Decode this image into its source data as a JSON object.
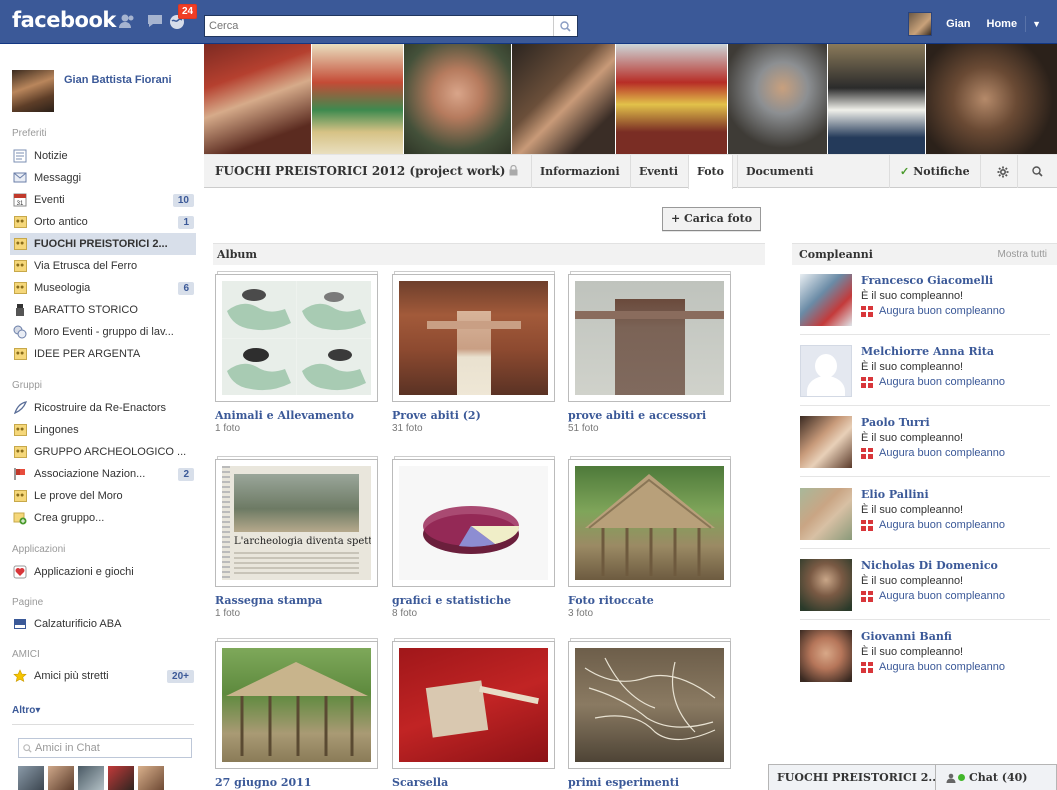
{
  "topbar": {
    "logo": "facebook",
    "notification_count": "24",
    "search_placeholder": "Cerca",
    "user_name": "Gian",
    "home_label": "Home"
  },
  "sidebar": {
    "profile_name": "Gian Battista Fiorani",
    "sections": {
      "preferiti": "Preferiti",
      "gruppi": "Gruppi",
      "applicazioni": "Applicazioni",
      "pagine": "Pagine",
      "amici": "AMICI"
    },
    "preferiti": [
      {
        "label": "Notizie",
        "count": "",
        "icon": "news-icon"
      },
      {
        "label": "Messaggi",
        "count": "",
        "icon": "messages-icon"
      },
      {
        "label": "Eventi",
        "count": "10",
        "icon": "calendar-icon"
      },
      {
        "label": "Orto antico",
        "count": "1",
        "icon": "group-icon"
      },
      {
        "label": "FUOCHI PREISTORICI 2...",
        "count": "",
        "icon": "group-icon"
      },
      {
        "label": "Via Etrusca del Ferro",
        "count": "",
        "icon": "group-icon"
      },
      {
        "label": "Museologia",
        "count": "6",
        "icon": "group-icon"
      },
      {
        "label": "BARATTO STORICO",
        "count": "",
        "icon": "figure-icon"
      },
      {
        "label": "Moro Eventi - gruppo di lav...",
        "count": "",
        "icon": "chat-group-icon"
      },
      {
        "label": "IDEE PER ARGENTA",
        "count": "",
        "icon": "group-icon"
      }
    ],
    "gruppi": [
      {
        "label": "Ricostruire da Re-Enactors",
        "count": "",
        "icon": "feather-icon"
      },
      {
        "label": "Lingones",
        "count": "",
        "icon": "group-icon"
      },
      {
        "label": "GRUPPO ARCHEOLOGICO ...",
        "count": "",
        "icon": "group-icon"
      },
      {
        "label": "Associazione Nazion...",
        "count": "2",
        "icon": "flag-icon"
      },
      {
        "label": "Le prove del Moro",
        "count": "",
        "icon": "group-icon"
      },
      {
        "label": "Crea gruppo...",
        "count": "",
        "icon": "add-group-icon"
      }
    ],
    "applicazioni": [
      {
        "label": "Applicazioni e giochi",
        "count": "",
        "icon": "apps-icon"
      }
    ],
    "pagine": [
      {
        "label": "Calzaturificio ABA",
        "count": "",
        "icon": "page-icon"
      }
    ],
    "amici": [
      {
        "label": "Amici più stretti",
        "count": "20+",
        "icon": "star-icon"
      }
    ],
    "altro": "Altro",
    "chat_search_placeholder": "Amici in Chat"
  },
  "group": {
    "title": "FUOCHI PREISTORICI 2012 (project work)",
    "tabs": [
      "Informazioni",
      "Eventi",
      "Foto",
      "Documenti"
    ],
    "active_tab": "Foto",
    "notifications": "Notifiche"
  },
  "upload_button": "+ Carica foto",
  "albums_header": "Album",
  "albums": [
    {
      "title": "Animali e Allevamento",
      "count": "1 foto"
    },
    {
      "title": "Prove abiti (2)",
      "count": "31 foto"
    },
    {
      "title": "prove abiti e accessori",
      "count": "51 foto"
    },
    {
      "title": "Rassegna stampa",
      "count": "1 foto",
      "thumb_text": "L'archeologia diventa spettac"
    },
    {
      "title": "grafici e statistiche",
      "count": "8 foto"
    },
    {
      "title": "Foto ritoccate",
      "count": "3 foto"
    },
    {
      "title": "27 giugno 2011",
      "count": ""
    },
    {
      "title": "Scarsella",
      "count": ""
    },
    {
      "title": "primi esperimenti",
      "count": ""
    }
  ],
  "birthdays": {
    "title": "Compleanni",
    "show_all": "Mostra tutti",
    "items": [
      {
        "name": "Francesco Giacomelli",
        "msg": "È il suo compleanno!",
        "action": "Augura buon compleanno"
      },
      {
        "name": "Melchiorre Anna Rita",
        "msg": "È il suo compleanno!",
        "action": "Augura buon compleanno"
      },
      {
        "name": "Paolo Turri",
        "msg": "È il suo compleanno!",
        "action": "Augura buon compleanno"
      },
      {
        "name": "Elio Pallini",
        "msg": "È il suo compleanno!",
        "action": "Augura buon compleanno"
      },
      {
        "name": "Nicholas Di Domenico",
        "msg": "È il suo compleanno!",
        "action": "Augura buon compleanno"
      },
      {
        "name": "Giovanni Banfi",
        "msg": "È il suo compleanno!",
        "action": "Augura buon compleanno"
      }
    ]
  },
  "chatbar": {
    "group_tab": "FUOCHI PREISTORICI 2...",
    "chat_label": "Chat (40)"
  },
  "colors": {
    "brand": "#3b5998",
    "badge": "#f03d25",
    "link": "#3b5998"
  }
}
